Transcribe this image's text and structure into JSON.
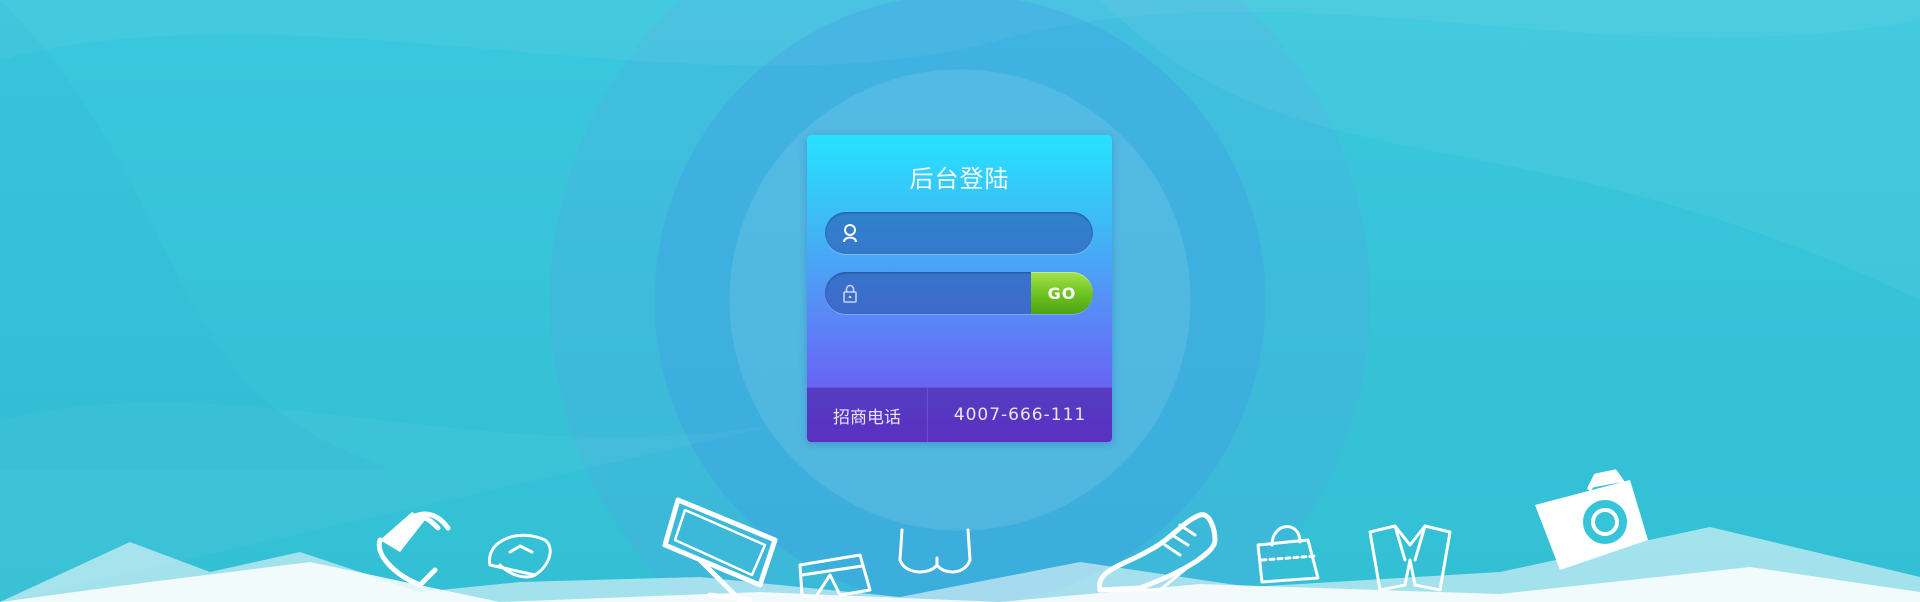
{
  "login": {
    "title": "后台登陆",
    "username": {
      "value": "",
      "placeholder": ""
    },
    "password": {
      "value": "",
      "placeholder": ""
    },
    "submit_label": "GO"
  },
  "footer": {
    "label": "招商电话",
    "phone": "4007-666-111"
  },
  "colors": {
    "background": "#36c4d8",
    "card_top": "#26e2ff",
    "card_bottom": "#7448f5",
    "go_button": "#6cc221"
  },
  "decor_icons": [
    "phone-icon",
    "hat-icon",
    "tv-icon",
    "shorts-icon",
    "bra-icon",
    "sneaker-icon",
    "handbag-icon",
    "suit-icon",
    "camera-icon"
  ]
}
